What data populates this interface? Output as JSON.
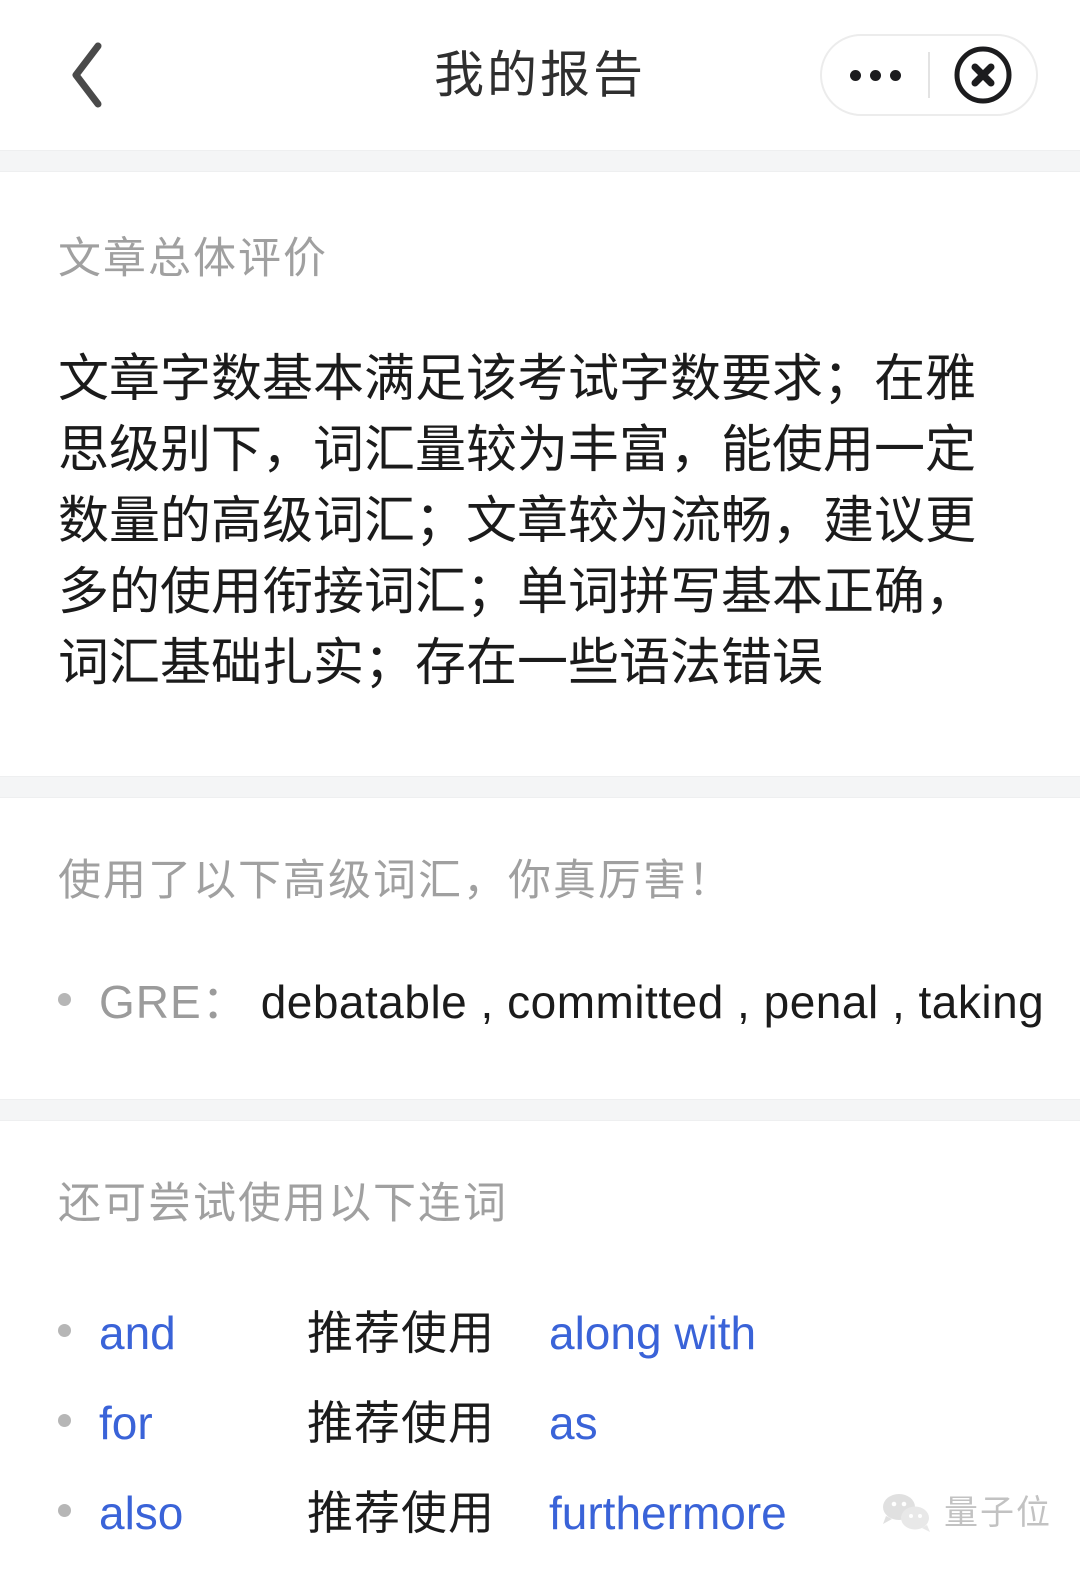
{
  "header": {
    "title": "我的报告",
    "back_icon": "chevron-left-icon",
    "more_icon": "more-dots-icon",
    "close_icon": "close-circle-icon"
  },
  "overall": {
    "title": "文章总体评价",
    "body": "文章字数基本满足该考试字数要求；在雅思级别下，词汇量较为丰富，能使用一定数量的高级词汇；文章较为流畅，建议更多的使用衔接词汇；单词拼写基本正确，词汇基础扎实；存在一些语法错误"
  },
  "advanced_vocab": {
    "title": "使用了以下高级词汇，你真厉害！",
    "rows": [
      {
        "label": "GRE：",
        "words": "debatable , committed , penal , taking"
      }
    ]
  },
  "conjunctions": {
    "title": "还可尝试使用以下连词",
    "rows": [
      {
        "from": "and",
        "hint": "推荐使用",
        "to": "along with"
      },
      {
        "from": "for",
        "hint": "推荐使用",
        "to": "as"
      },
      {
        "from": "also",
        "hint": "推荐使用",
        "to": "furthermore"
      }
    ]
  },
  "watermark": {
    "text": "量子位",
    "icon": "wechat-logo-icon"
  },
  "colors": {
    "accent_blue": "#3a63d8",
    "text_primary": "#1b1b1b",
    "text_muted": "#a0a0a0",
    "divider": "#f4f5f6"
  }
}
